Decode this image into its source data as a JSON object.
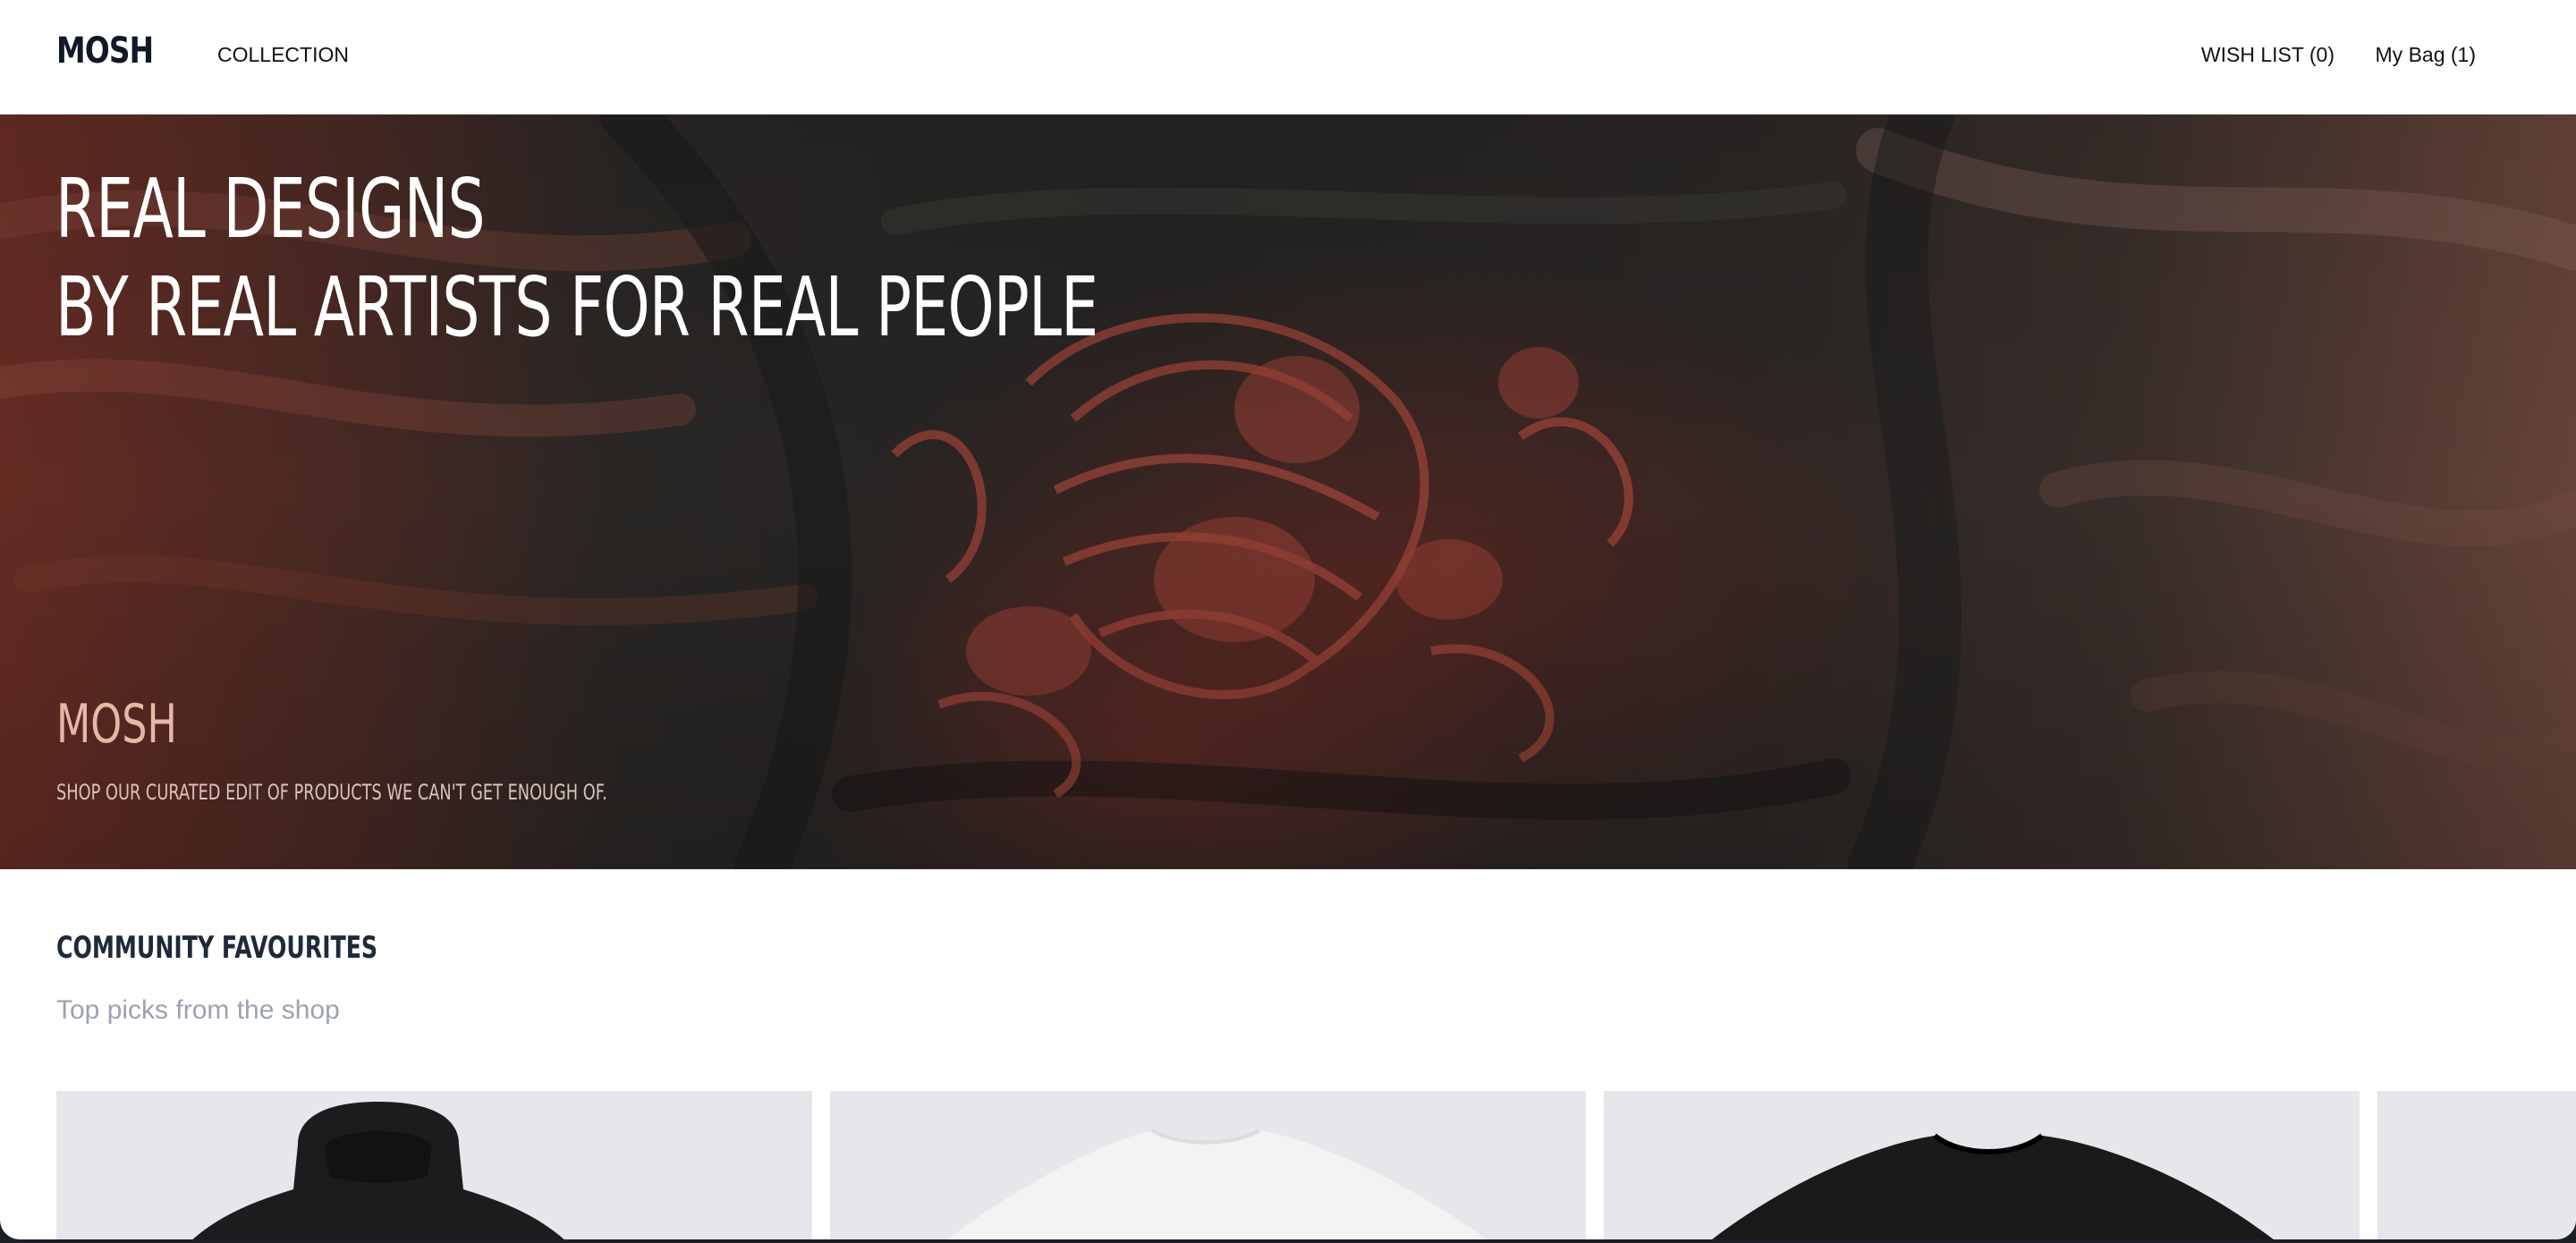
{
  "header": {
    "logo": "MOSH",
    "nav": {
      "collection": "COLLECTION",
      "wishlist": "WISH LIST (0)",
      "bag": "My Bag (1)"
    }
  },
  "hero": {
    "title_line_1": "REAL DESIGNS",
    "title_line_2": "BY REAL ARTISTS FOR REAL PEOPLE",
    "brand": "MOSH",
    "subtitle": "SHOP OUR CURATED EDIT OF PRODUCTS WE CAN'T GET ENOUGH OF."
  },
  "section": {
    "title": "COMMUNITY FAVOURITES",
    "subtitle": "Top picks from the shop"
  },
  "products": [
    {
      "image": "black-hoodie"
    },
    {
      "image": "white-tshirt"
    },
    {
      "image": "black-tshirt"
    },
    {
      "image": "product-partial"
    }
  ],
  "colors": {
    "text_dark": "#111827",
    "muted": "#9ca3af",
    "card_bg": "#e7e7eb",
    "hero_brand": "#e6b8a6"
  }
}
